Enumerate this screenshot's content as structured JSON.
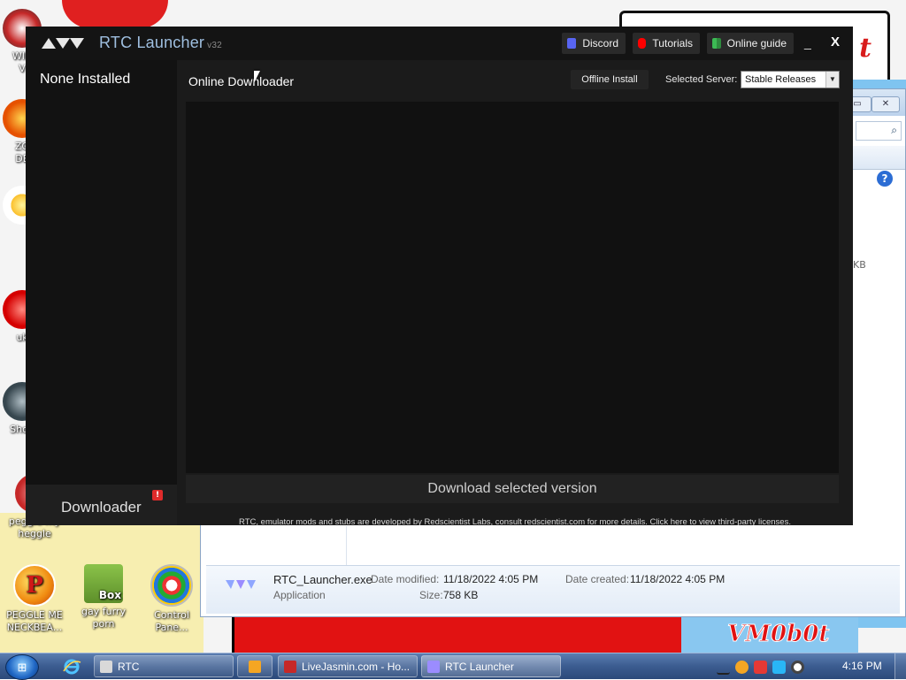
{
  "desktop": {
    "wallpaper_text": "VM0b0t",
    "banner_text": "t",
    "icons": [
      {
        "label": "WIN\nV",
        "name": "desktop-icon-win"
      },
      {
        "label": "ZO\nDE",
        "name": "desktop-icon-zo"
      },
      {
        "label": "uk",
        "name": "desktop-icon-uk"
      },
      {
        "label": "Shop",
        "name": "desktop-icon-shop"
      },
      {
        "label": "peggle my\nheggle",
        "name": "desktop-icon-peggle-my-heggle"
      },
      {
        "label": "PEGGLE ME\nNECKBEA...",
        "name": "desktop-icon-peggle-me"
      },
      {
        "label": "gay furry\nporn",
        "name": "desktop-icon-box"
      },
      {
        "label": "Control Pane...",
        "name": "desktop-icon-control-panel"
      }
    ],
    "box_text": "Box"
  },
  "explorer": {
    "kb_fragment": "KB",
    "help_glyph": "?",
    "search_glyph": "⌕",
    "details": {
      "filename": "RTC_Launcher.exe",
      "type": "Application",
      "date_modified_label": "Date modified:",
      "date_modified": "11/18/2022 4:05 PM",
      "date_created_label": "Date created:",
      "date_created": "11/18/2022 4:05 PM",
      "size_label": "Size:",
      "size": "758 KB"
    }
  },
  "launcher": {
    "title": "RTC Launcher",
    "version": "v32",
    "top_buttons": {
      "discord": "Discord",
      "tutorials": "Tutorials",
      "online_guide": "Online guide"
    },
    "minimize_glyph": "_",
    "close_glyph": "X",
    "sidebar": {
      "installed_label": "None Installed",
      "downloader_label": "Downloader",
      "badge": "!"
    },
    "main": {
      "title": "Online Downloader",
      "offline_install": "Offline Install",
      "server_label": "Selected Server:",
      "server_value": "Stable Releases",
      "download_button": "Download selected version",
      "footer": "RTC, emulator mods and stubs are developed by Redscientist Labs, consult redscientist.com for more details. Click here to view third-party licenses.",
      "footer_ellipsis": "..."
    }
  },
  "taskbar": {
    "buttons": [
      {
        "label": "RTC",
        "name": "taskbar-rtc"
      },
      {
        "label": "LiveJasmin.com - Ho...",
        "name": "taskbar-livejasmin"
      },
      {
        "label": "RTC Launcher",
        "name": "taskbar-rtc-launcher"
      }
    ],
    "clock": "4:16 PM"
  },
  "colors": {
    "launcher_bg": "#1b1b1b",
    "launcher_title": "#9fbfe0",
    "discord": "#5865f2",
    "youtube": "#ff0000",
    "online_guide": "#3cba54",
    "badge": "#e02b2b"
  }
}
